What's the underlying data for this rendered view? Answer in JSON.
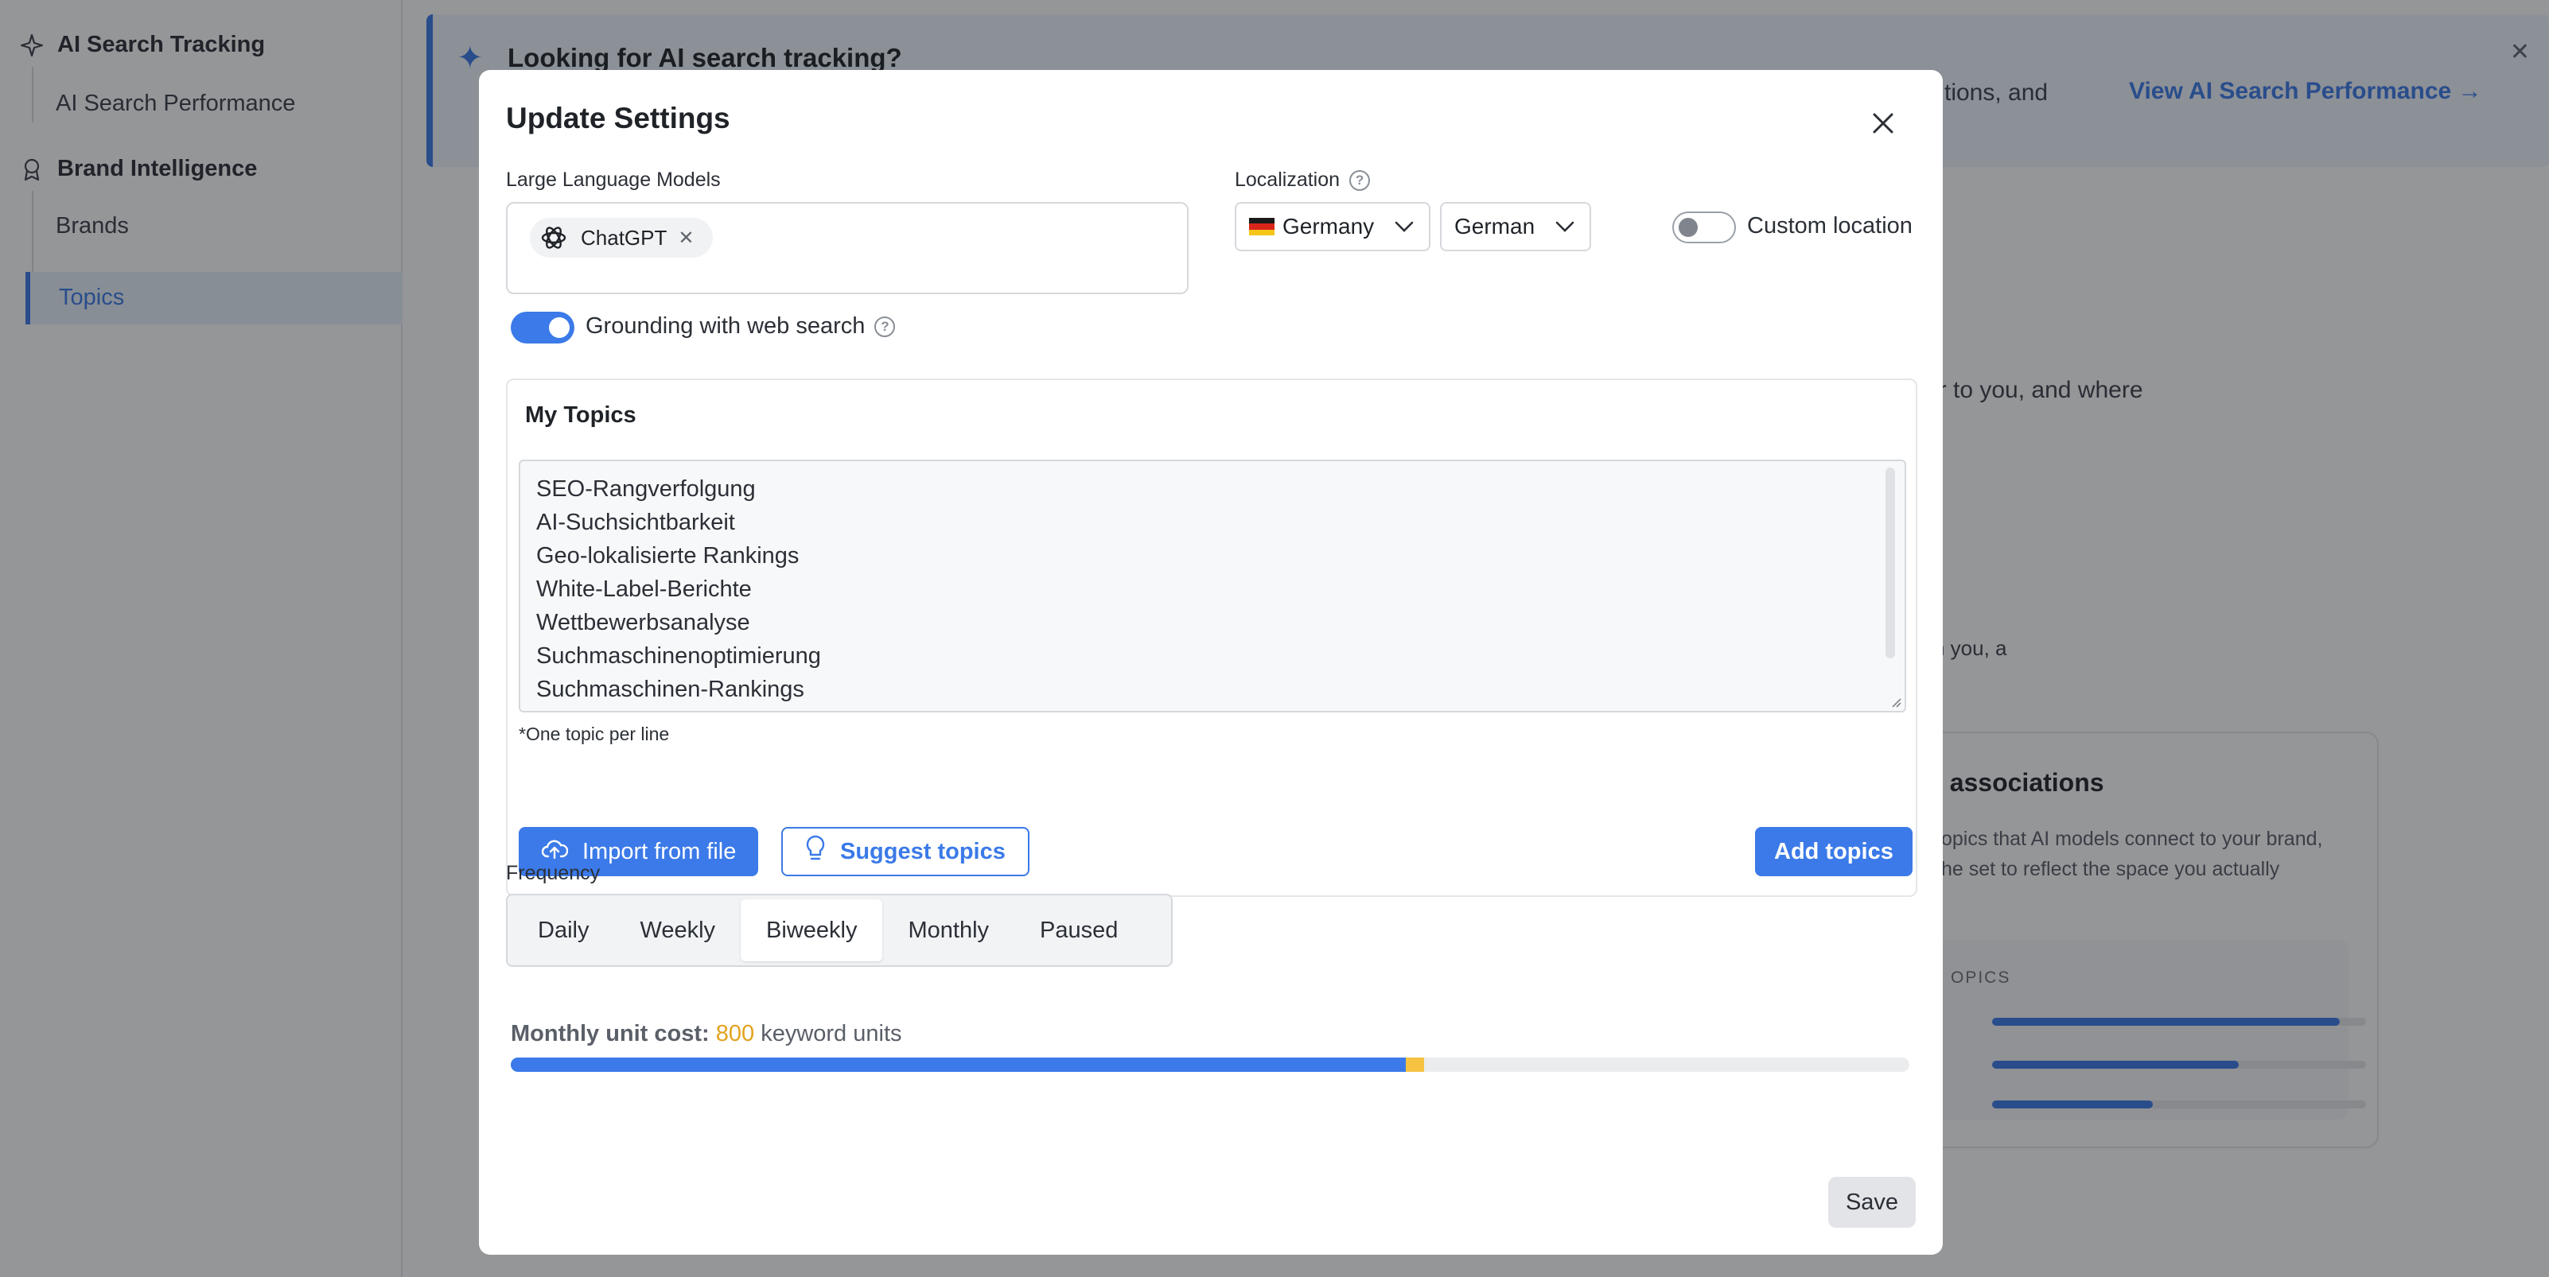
{
  "sidebar": {
    "groups": [
      {
        "label": "AI Search Tracking",
        "icon": "sparkle-outline-icon",
        "items": [
          "AI Search Performance"
        ]
      },
      {
        "label": "Brand Intelligence",
        "icon": "award-icon",
        "items": [
          "Brands",
          "Topics"
        ]
      }
    ],
    "active_item": "Topics"
  },
  "banner": {
    "title": "Looking for AI search tracking?",
    "text_fragment": "tions, and",
    "link": "View AI Search Performance →"
  },
  "background": {
    "text_fragment_1": "er to you, and where",
    "text_fragment_2": "h you, a",
    "card": {
      "title": "c associations",
      "desc_line1": "opics that AI models connect to your brand,",
      "desc_line2": "he set to reflect the space you actually",
      "label": "OPICS",
      "bars": [
        0.93,
        0.66,
        0.43
      ]
    }
  },
  "modal": {
    "title": "Update Settings",
    "llm": {
      "label": "Large Language Models",
      "chips": [
        {
          "name": "ChatGPT",
          "icon": "openai-logo-icon"
        }
      ]
    },
    "localization": {
      "label": "Localization",
      "country": "Germany",
      "language": "German",
      "custom_location_label": "Custom location",
      "custom_location_on": false
    },
    "grounding": {
      "label": "Grounding with web search",
      "on": true
    },
    "topics": {
      "title": "My Topics",
      "lines": [
        "SEO-Rangverfolgung",
        "AI-Suchsichtbarkeit",
        "Geo-lokalisierte Rankings",
        "White-Label-Berichte",
        "Wettbewerbsanalyse",
        "Suchmaschinenoptimierung",
        "Suchmaschinen-Rankings"
      ],
      "hint": "*One topic per line",
      "import_label": "Import from file",
      "suggest_label": "Suggest topics",
      "add_label": "Add topics"
    },
    "frequency": {
      "label": "Frequency",
      "options": [
        "Daily",
        "Weekly",
        "Biweekly",
        "Monthly",
        "Paused"
      ],
      "selected": "Biweekly"
    },
    "cost": {
      "label": "Monthly unit cost:",
      "value": "800",
      "unit": "keyword units",
      "used_fraction": 0.64,
      "added_fraction": 0.013
    },
    "save_label": "Save"
  },
  "colors": {
    "accent": "#3b7ae8",
    "cost_value": "#e2a21e",
    "added": "#f5c242"
  }
}
